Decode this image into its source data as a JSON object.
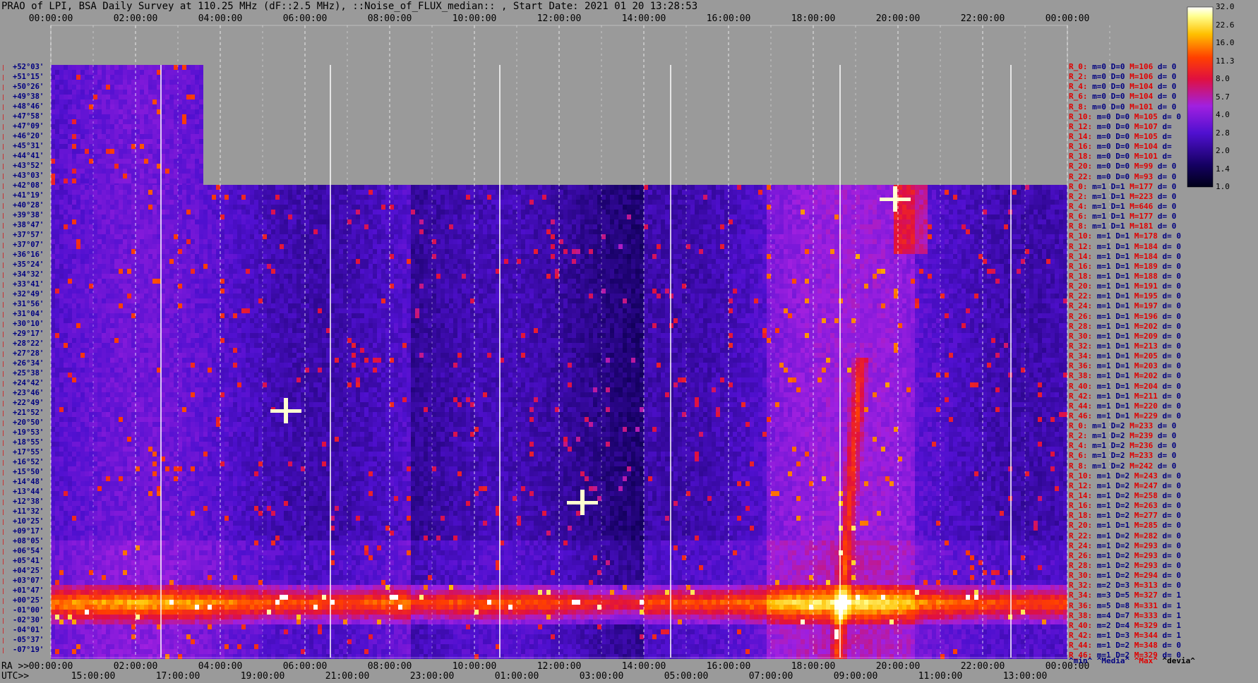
{
  "title": "PRAO of LPI, BSA Daily Survey at 110.25 MHz (dF::2.5 MHz), ::Noise_of_FLUX_median:: , Start Date: 2021 01 20 13:28:53",
  "chart_data": {
    "type": "heatmap",
    "title": "PRAO of LPI, BSA Daily Survey at 110.25 MHz (dF::2.5 MHz), ::Noise_of_FLUX_median:: , Start Date: 2021 01 20 13:28:53",
    "top_axis_labels": [
      "00:00:00",
      "02:00:00",
      "04:00:00",
      "06:00:00",
      "08:00:00",
      "10:00:00",
      "12:00:00",
      "14:00:00",
      "16:00:00",
      "18:00:00",
      "20:00:00",
      "22:00:00",
      "00:00:00"
    ],
    "bottom_ra_prefix": "RA >>",
    "bottom_ra_labels": [
      "00:00:00",
      "02:00:00",
      "04:00:00",
      "06:00:00",
      "08:00:00",
      "10:00:00",
      "12:00:00",
      "14:00:00",
      "16:00:00",
      "18:00:00",
      "20:00:00",
      "22:00:00",
      "00:00:00"
    ],
    "bottom_utc_prefix": "UTC>>",
    "bottom_utc_labels": [
      "15:00:00",
      "17:00:00",
      "19:00:00",
      "21:00:00",
      "23:00:00",
      "01:00:00",
      "03:00:00",
      "05:00:00",
      "07:00:00",
      "09:00:00",
      "11:00:00",
      "13:00:00"
    ],
    "declination_labels": [
      "+52°03'",
      "+51°15'",
      "+50°26'",
      "+49°38'",
      "+48°46'",
      "+47°58'",
      "+47°09'",
      "+46°20'",
      "+45°31'",
      "+44°41'",
      "+43°52'",
      "+43°03'",
      "+42°08'",
      "+41°19'",
      "+40°28'",
      "+39°38'",
      "+38°47'",
      "+37°57'",
      "+37°07'",
      "+36°16'",
      "+35°24'",
      "+34°32'",
      "+33°41'",
      "+32°49'",
      "+31°56'",
      "+31°04'",
      "+30°10'",
      "+29°17'",
      "+28°22'",
      "+27°28'",
      "+26°34'",
      "+25°38'",
      "+24°42'",
      "+23°46'",
      "+22°49'",
      "+21°52'",
      "+20°50'",
      "+19°53'",
      "+18°55'",
      "+17°55'",
      "+16°52'",
      "+15°50'",
      "+14°48'",
      "+13°44'",
      "+12°38'",
      "+11°32'",
      "+10°25'",
      "+09°17'",
      "+08°05'",
      "+06°54'",
      "+05°41'",
      "+04°25'",
      "+03°07'",
      "+01°47'",
      "+00°25'",
      "-01°00'",
      "-02°30'",
      "-04°01'",
      "-05°37'",
      "-07°19'"
    ],
    "colorbar": {
      "ticks": [
        "32.0",
        "22.6",
        "16.0",
        "11.3",
        "8.0",
        "5.7",
        "4.0",
        "2.8",
        "2.0",
        "1.4",
        "1.0"
      ],
      "scale": "log",
      "range": [
        1.0,
        32.0
      ]
    },
    "colors": {
      "background": "#9a9a9a",
      "low": "#000020",
      "mid": "#7a18ff",
      "high": "#ff2000",
      "peak": "#ffffff"
    }
  },
  "rows": [
    {
      "r": "R_0:",
      "m": "m=0",
      "d": "D=0",
      "M": "M=106",
      "dv": "d= 0"
    },
    {
      "r": "R_2:",
      "m": "m=0",
      "d": "D=0",
      "M": "M=106",
      "dv": "d= 0"
    },
    {
      "r": "R_4:",
      "m": "m=0",
      "d": "D=0",
      "M": "M=104",
      "dv": "d= 0"
    },
    {
      "r": "R_6:",
      "m": "m=0",
      "d": "D=0",
      "M": "M=104",
      "dv": "d= 0"
    },
    {
      "r": "R_8:",
      "m": "m=0",
      "d": "D=0",
      "M": "M=101",
      "dv": "d= 0"
    },
    {
      "r": "R_10:",
      "m": "m=0",
      "d": "D=0",
      "M": "M=105",
      "dv": "d= 0"
    },
    {
      "r": "R_12:",
      "m": "m=0",
      "d": "D=0",
      "M": "M=107",
      "dv": "d="
    },
    {
      "r": "R_14:",
      "m": "m=0",
      "d": "D=0",
      "M": "M=105",
      "dv": "d="
    },
    {
      "r": "R_16:",
      "m": "m=0",
      "d": "D=0",
      "M": "M=104",
      "dv": "d="
    },
    {
      "r": "R_18:",
      "m": "m=0",
      "d": "D=0",
      "M": "M=101",
      "dv": "d="
    },
    {
      "r": "R_20:",
      "m": "m=0",
      "d": "D=0",
      "M": "M=99",
      "dv": "d= 0"
    },
    {
      "r": "R_22:",
      "m": "m=0",
      "d": "D=0",
      "M": "M=93",
      "dv": "d= 0"
    },
    {
      "r": "R_0:",
      "m": "m=1",
      "d": "D=1",
      "M": "M=177",
      "dv": "d= 0"
    },
    {
      "r": "R_2:",
      "m": "m=1",
      "d": "D=1",
      "M": "M=223",
      "dv": "d= 0"
    },
    {
      "r": "R_4:",
      "m": "m=1",
      "d": "D=1",
      "M": "M=646",
      "dv": "d= 0"
    },
    {
      "r": "R_6:",
      "m": "m=1",
      "d": "D=1",
      "M": "M=177",
      "dv": "d= 0"
    },
    {
      "r": "R_8:",
      "m": "m=1",
      "d": "D=1",
      "M": "M=181",
      "dv": "d= 0"
    },
    {
      "r": "R_10:",
      "m": "m=1",
      "d": "D=1",
      "M": "M=178",
      "dv": "d= 0"
    },
    {
      "r": "R_12:",
      "m": "m=1",
      "d": "D=1",
      "M": "M=184",
      "dv": "d= 0"
    },
    {
      "r": "R_14:",
      "m": "m=1",
      "d": "D=1",
      "M": "M=184",
      "dv": "d= 0"
    },
    {
      "r": "R_16:",
      "m": "m=1",
      "d": "D=1",
      "M": "M=189",
      "dv": "d= 0"
    },
    {
      "r": "R_18:",
      "m": "m=1",
      "d": "D=1",
      "M": "M=188",
      "dv": "d= 0"
    },
    {
      "r": "R_20:",
      "m": "m=1",
      "d": "D=1",
      "M": "M=191",
      "dv": "d= 0"
    },
    {
      "r": "R_22:",
      "m": "m=1",
      "d": "D=1",
      "M": "M=195",
      "dv": "d= 0"
    },
    {
      "r": "R_24:",
      "m": "m=1",
      "d": "D=1",
      "M": "M=197",
      "dv": "d= 0"
    },
    {
      "r": "R_26:",
      "m": "m=1",
      "d": "D=1",
      "M": "M=196",
      "dv": "d= 0"
    },
    {
      "r": "R_28:",
      "m": "m=1",
      "d": "D=1",
      "M": "M=202",
      "dv": "d= 0"
    },
    {
      "r": "R_30:",
      "m": "m=1",
      "d": "D=1",
      "M": "M=209",
      "dv": "d= 0"
    },
    {
      "r": "R_32:",
      "m": "m=1",
      "d": "D=1",
      "M": "M=213",
      "dv": "d= 0"
    },
    {
      "r": "R_34:",
      "m": "m=1",
      "d": "D=1",
      "M": "M=205",
      "dv": "d= 0"
    },
    {
      "r": "R_36:",
      "m": "m=1",
      "d": "D=1",
      "M": "M=203",
      "dv": "d= 0"
    },
    {
      "r": "R_38:",
      "m": "m=1",
      "d": "D=1",
      "M": "M=202",
      "dv": "d= 0"
    },
    {
      "r": "R_40:",
      "m": "m=1",
      "d": "D=1",
      "M": "M=204",
      "dv": "d= 0"
    },
    {
      "r": "R_42:",
      "m": "m=1",
      "d": "D=1",
      "M": "M=211",
      "dv": "d= 0"
    },
    {
      "r": "R_44:",
      "m": "m=1",
      "d": "D=1",
      "M": "M=220",
      "dv": "d= 0"
    },
    {
      "r": "R_46:",
      "m": "m=1",
      "d": "D=1",
      "M": "M=229",
      "dv": "d= 0"
    },
    {
      "r": "R_0:",
      "m": "m=1",
      "d": "D=2",
      "M": "M=233",
      "dv": "d= 0"
    },
    {
      "r": "R_2:",
      "m": "m=1",
      "d": "D=2",
      "M": "M=239",
      "dv": "d= 0"
    },
    {
      "r": "R_4:",
      "m": "m=1",
      "d": "D=2",
      "M": "M=236",
      "dv": "d= 0"
    },
    {
      "r": "R_6:",
      "m": "m=1",
      "d": "D=2",
      "M": "M=233",
      "dv": "d= 0"
    },
    {
      "r": "R_8:",
      "m": "m=1",
      "d": "D=2",
      "M": "M=242",
      "dv": "d= 0"
    },
    {
      "r": "R_10:",
      "m": "m=1",
      "d": "D=2",
      "M": "M=243",
      "dv": "d= 0"
    },
    {
      "r": "R_12:",
      "m": "m=1",
      "d": "D=2",
      "M": "M=247",
      "dv": "d= 0"
    },
    {
      "r": "R_14:",
      "m": "m=1",
      "d": "D=2",
      "M": "M=258",
      "dv": "d= 0"
    },
    {
      "r": "R_16:",
      "m": "m=1",
      "d": "D=2",
      "M": "M=263",
      "dv": "d= 0"
    },
    {
      "r": "R_18:",
      "m": "m=1",
      "d": "D=2",
      "M": "M=277",
      "dv": "d= 0"
    },
    {
      "r": "R_20:",
      "m": "m=1",
      "d": "D=1",
      "M": "M=285",
      "dv": "d= 0"
    },
    {
      "r": "R_22:",
      "m": "m=1",
      "d": "D=2",
      "M": "M=282",
      "dv": "d= 0"
    },
    {
      "r": "R_24:",
      "m": "m=1",
      "d": "D=2",
      "M": "M=293",
      "dv": "d= 0"
    },
    {
      "r": "R_26:",
      "m": "m=1",
      "d": "D=2",
      "M": "M=293",
      "dv": "d= 0"
    },
    {
      "r": "R_28:",
      "m": "m=1",
      "d": "D=2",
      "M": "M=293",
      "dv": "d= 0"
    },
    {
      "r": "R_30:",
      "m": "m=1",
      "d": "D=2",
      "M": "M=294",
      "dv": "d= 0"
    },
    {
      "r": "R_32:",
      "m": "m=2",
      "d": "D=3",
      "M": "M=313",
      "dv": "d= 0"
    },
    {
      "r": "R_34:",
      "m": "m=3",
      "d": "D=5",
      "M": "M=327",
      "dv": "d= 1"
    },
    {
      "r": "R_36:",
      "m": "m=5",
      "d": "D=8",
      "M": "M=331",
      "dv": "d= 1"
    },
    {
      "r": "R_38:",
      "m": "m=4",
      "d": "D=7",
      "M": "M=333",
      "dv": "d= 1"
    },
    {
      "r": "R_40:",
      "m": "m=2",
      "d": "D=4",
      "M": "M=329",
      "dv": "d= 1"
    },
    {
      "r": "R_42:",
      "m": "m=1",
      "d": "D=3",
      "M": "M=344",
      "dv": "d= 1"
    },
    {
      "r": "R_44:",
      "m": "m=1",
      "d": "D=2",
      "M": "M=348",
      "dv": "d= 0"
    },
    {
      "r": "R_46:",
      "m": "m=1",
      "d": "D=2",
      "M": "M=329",
      "dv": "d= 0"
    }
  ],
  "footer": {
    "min": "^min^",
    "median": "^Media^",
    "max": "^Max^",
    "devia": "^devia^"
  }
}
